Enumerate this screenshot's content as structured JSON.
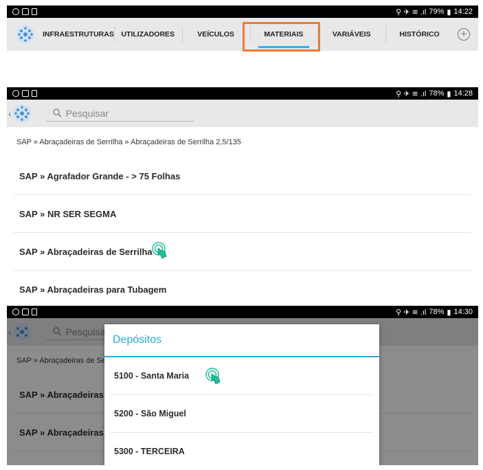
{
  "screen1": {
    "status": {
      "battery": "79%",
      "time": "14:22"
    },
    "tabs": [
      "INFRAESTRUTURAS",
      "UTILIZADORES",
      "VEÍCULOS",
      "MATERIAIS",
      "VARIÁVEIS",
      "HISTÓRICO"
    ],
    "active_tab": "MATERIAIS",
    "highlight_color": "#ef7a31",
    "accent": "#29b6e8"
  },
  "screen2": {
    "status": {
      "battery": "78%",
      "time": "14:28"
    },
    "search_placeholder": "Pesquisar",
    "breadcrumb": "SAP » Abraçadeiras de Serrilha » Abraçadeiras de Serrilha 2,5/135",
    "items": [
      "SAP »  Agrafador Grande - > 75 Folhas",
      "SAP »  NR SER SEGMA",
      "SAP » Abraçadeiras de Serrilha",
      "SAP » Abraçadeiras para Tubagem"
    ]
  },
  "screen3": {
    "status": {
      "battery": "78%",
      "time": "14:30"
    },
    "search_placeholder": "Pesquisar",
    "breadcrumb_fragment": "SAP » Abraçadeiras de Ser",
    "bg_items": [
      "SAP » Abraçadeiras d",
      "SAP » Abraçadeiras d"
    ],
    "dialog_title": "Depósitos",
    "dialog_items": [
      "5100 - Santa Maria",
      "5200 - São Miguel",
      "5300 - TERCEIRA"
    ],
    "title_color": "#29a9d9"
  },
  "icons": {
    "tap": "tap-gesture-icon",
    "search": "search-icon",
    "add": "plus-circle-icon"
  }
}
